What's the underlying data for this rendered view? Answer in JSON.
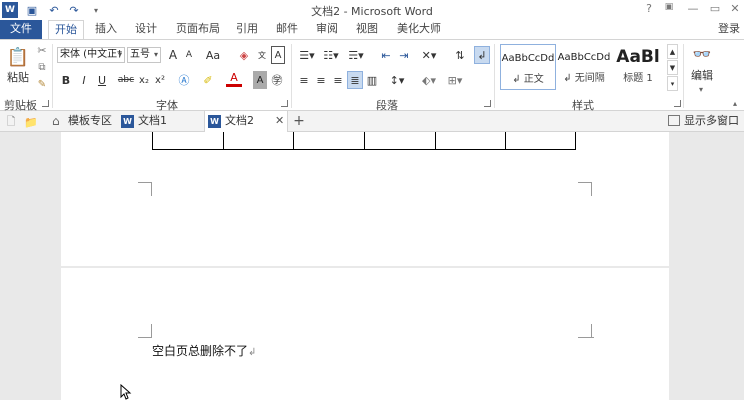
{
  "window": {
    "title": "文档2 - Microsoft Word",
    "help": "?",
    "minimize": "—",
    "restore": "▭",
    "close": "✕",
    "login": "登录"
  },
  "tabs": {
    "file": "文件",
    "items": [
      "开始",
      "插入",
      "设计",
      "页面布局",
      "引用",
      "邮件",
      "审阅",
      "视图",
      "美化大师"
    ]
  },
  "ribbon": {
    "clipboard": {
      "paste": "粘贴",
      "label": "剪贴板"
    },
    "font": {
      "name": "宋体 (中文正†",
      "size": "五号",
      "grow": "A",
      "shrink": "A",
      "case": "Aa",
      "bold": "B",
      "italic": "I",
      "underline": "U",
      "strike": "abc",
      "sub": "x₂",
      "sup": "x²",
      "label": "字体"
    },
    "paragraph": {
      "label": "段落"
    },
    "styles": {
      "label": "样式",
      "items": [
        {
          "sample": "AaBbCcDd",
          "name": "↲ 正文"
        },
        {
          "sample": "AaBbCcDd",
          "name": "↲ 无间隔"
        },
        {
          "sample": "AaBl",
          "name": "标题 1"
        }
      ]
    },
    "editing": {
      "label": "编辑"
    }
  },
  "doctabs": {
    "items": [
      "模板专区",
      "文档1",
      "文档2"
    ],
    "close": "✕",
    "add": "+",
    "show_multi": "显示多窗口"
  },
  "document": {
    "text": "空白页总删除不了",
    "para_mark": "↲"
  }
}
